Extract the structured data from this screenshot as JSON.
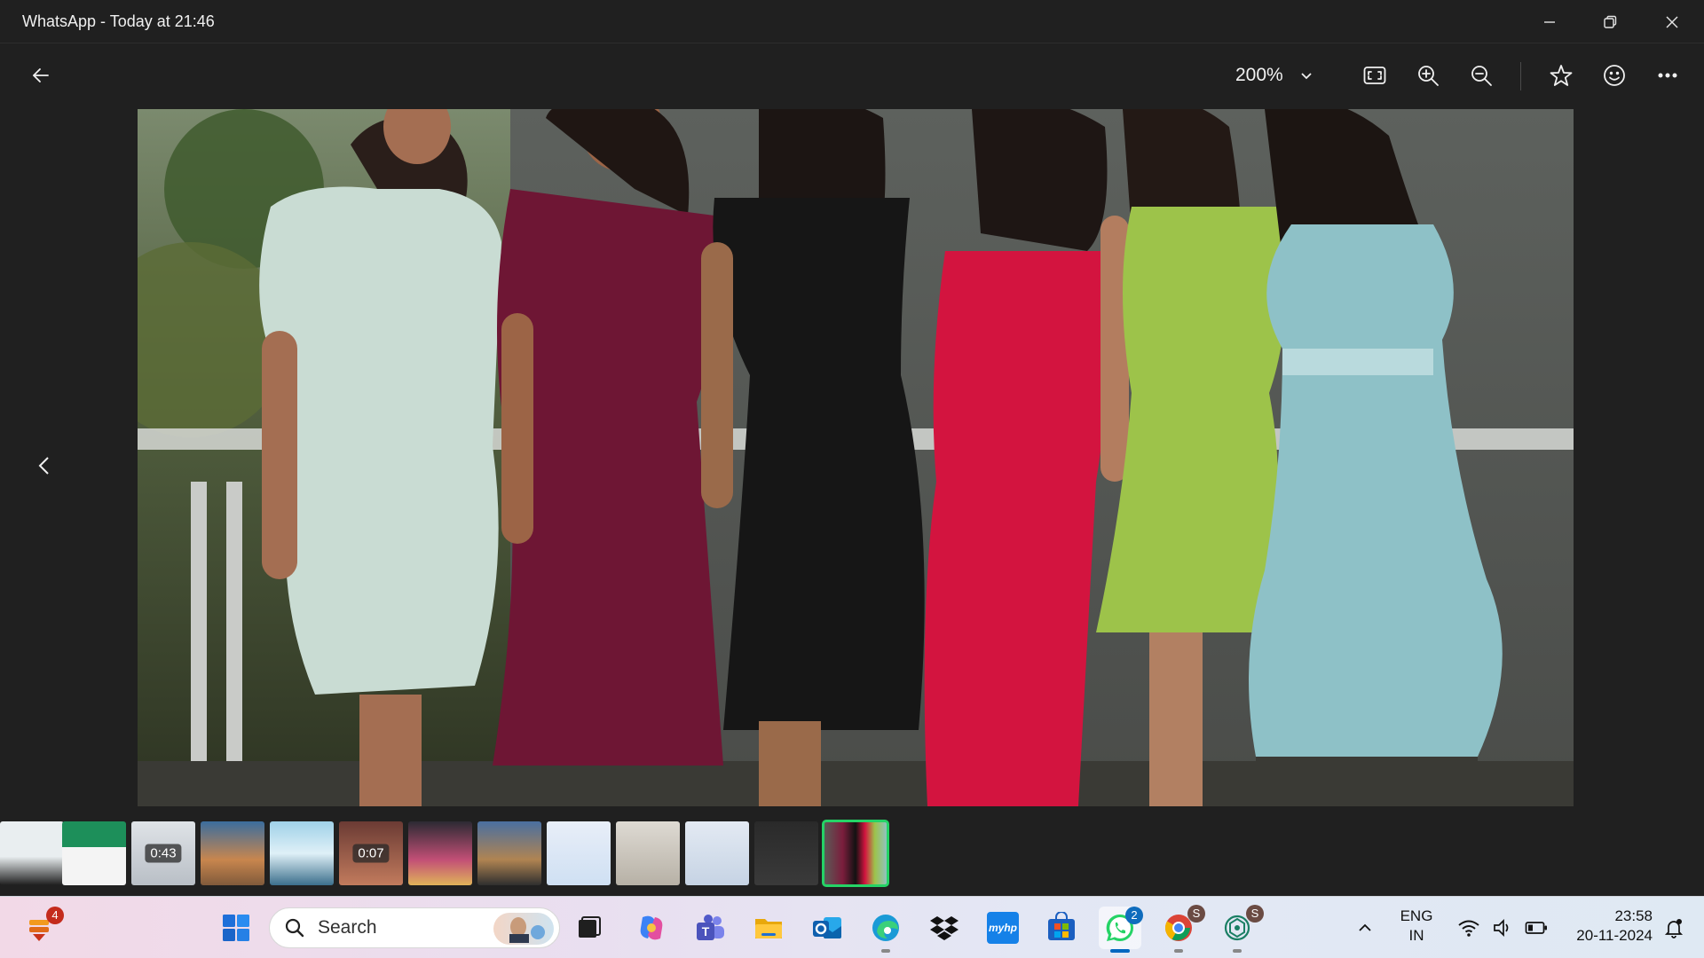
{
  "window": {
    "title": "WhatsApp - Today at 21:46"
  },
  "toolbar": {
    "zoom_level": "200%",
    "icons": [
      "back-arrow-icon",
      "fit-to-window-icon",
      "zoom-in-icon",
      "zoom-out-icon",
      "star-icon",
      "emoji-icon",
      "more-icon"
    ]
  },
  "filmstrip": {
    "thumbnails": [
      {
        "kind": "screenshot",
        "duration": ""
      },
      {
        "kind": "screenshot",
        "duration": ""
      },
      {
        "kind": "video",
        "duration": "0:43"
      },
      {
        "kind": "photo",
        "duration": ""
      },
      {
        "kind": "screenshot",
        "duration": ""
      },
      {
        "kind": "video",
        "duration": "0:07"
      },
      {
        "kind": "photo",
        "duration": ""
      },
      {
        "kind": "photo",
        "duration": ""
      },
      {
        "kind": "screenshot",
        "duration": ""
      },
      {
        "kind": "photo",
        "duration": ""
      },
      {
        "kind": "screenshot",
        "duration": ""
      },
      {
        "kind": "screenshot",
        "duration": ""
      },
      {
        "kind": "photo",
        "duration": "",
        "active": true
      }
    ]
  },
  "taskbar": {
    "widgets_badge": "4",
    "search_label": "Search",
    "whatsapp_badge": "2",
    "chrome_badge": "S",
    "chatgpt_badge": "S",
    "apps": [
      "start-icon",
      "search",
      "task-view-icon",
      "copilot-icon",
      "teams-icon",
      "file-explorer-icon",
      "outlook-icon",
      "edge-icon",
      "dropbox-icon",
      "myhp-icon",
      "store-icon",
      "whatsapp-icon",
      "chrome-icon",
      "chatgpt-icon"
    ],
    "myhp_label": "myhp",
    "language": "ENG",
    "region": "IN",
    "time": "23:58",
    "date": "20-11-2024"
  },
  "colors": {
    "accent_green": "#25d366",
    "taskbar_active": "#0067c0",
    "badge_red": "#c42b1c"
  }
}
